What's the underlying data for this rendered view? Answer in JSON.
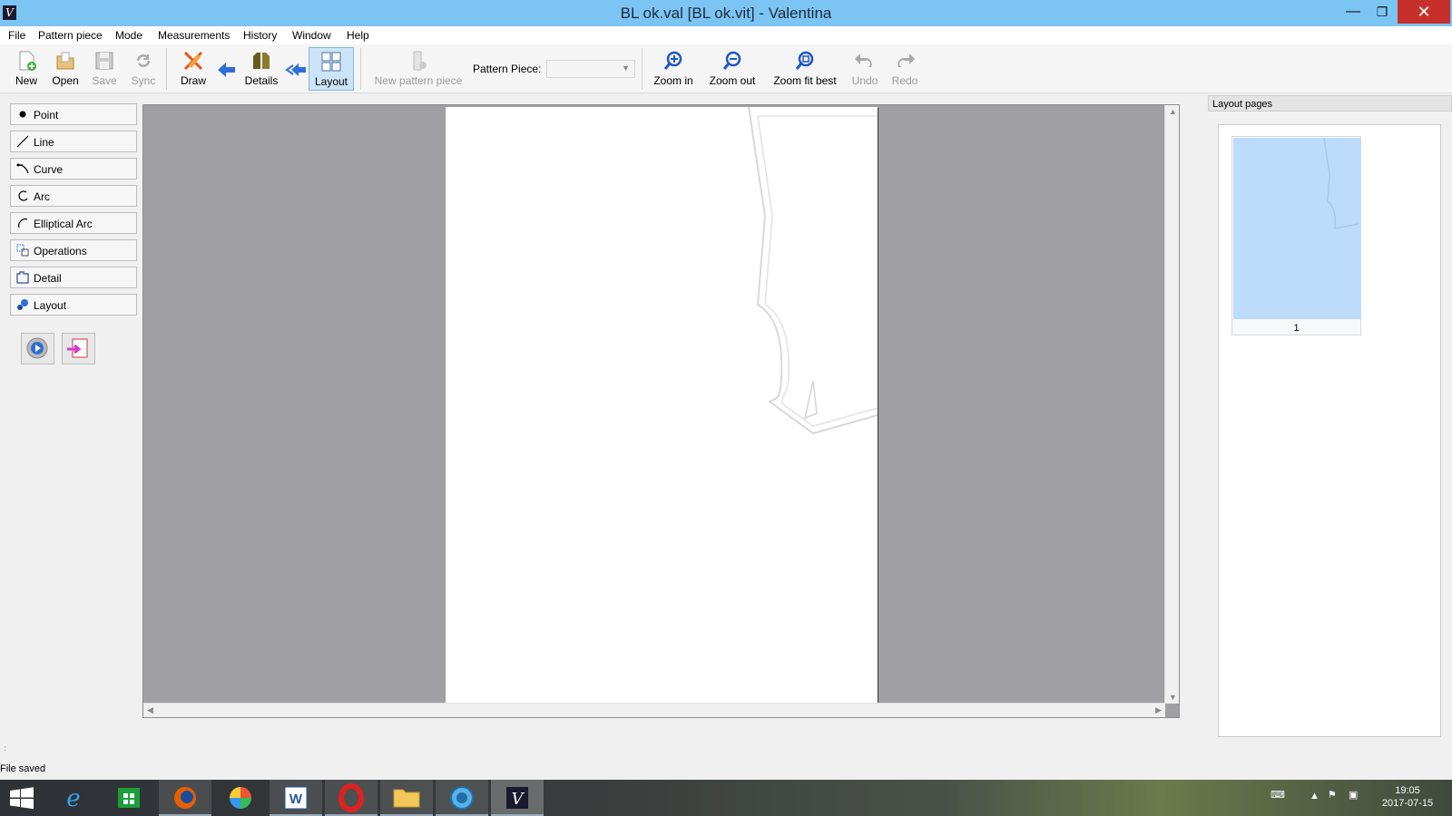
{
  "window": {
    "title": "BL ok.val [BL ok.vit] - Valentina",
    "app_icon_glyph": "V",
    "controls": {
      "minimize": "—",
      "maximize": "❐",
      "close": "✕"
    }
  },
  "menu": [
    "File",
    "Pattern piece",
    "Mode",
    "Measurements",
    "History",
    "Window",
    "Help"
  ],
  "toolbar": {
    "new_label": "New",
    "open_label": "Open",
    "save_label": "Save",
    "sync_label": "Sync",
    "draw_label": "Draw",
    "details_label": "Details",
    "layout_label": "Layout",
    "new_pattern_piece_label": "New pattern piece",
    "pattern_piece_label": "Pattern Piece:",
    "pattern_piece_value": "",
    "zoom_in_label": "Zoom in",
    "zoom_out_label": "Zoom out",
    "zoom_fit_best_label": "Zoom fit best",
    "undo_label": "Undo",
    "redo_label": "Redo"
  },
  "tools": [
    "Point",
    "Line",
    "Curve",
    "Arc",
    "Elliptical Arc",
    "Operations",
    "Detail",
    "Layout"
  ],
  "layout_pages": {
    "header": "Layout pages",
    "pages": [
      {
        "number": "1"
      }
    ]
  },
  "status": "File saved",
  "taskbar": {
    "clock_time": "19:05",
    "clock_date": "2017-07-15"
  },
  "colors": {
    "titlebar": "#7cc4f4",
    "close_button": "#c7302a",
    "canvas_bg": "#a0a0a4",
    "active_tool": "#cce4f7",
    "thumb_sheet": "#bddcfc"
  }
}
